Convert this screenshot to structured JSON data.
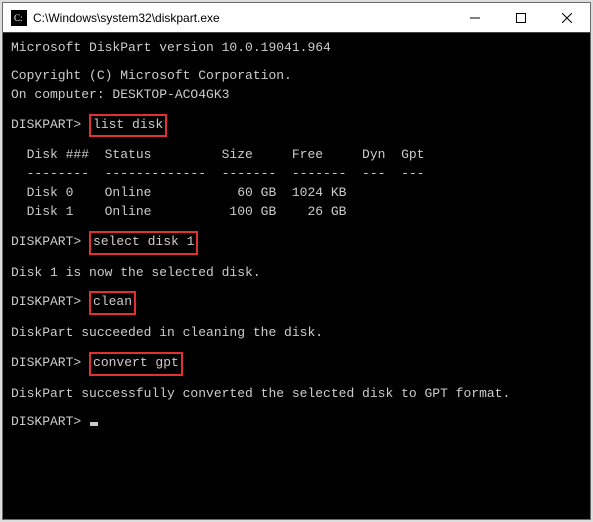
{
  "titlebar": {
    "title": "C:\\Windows\\system32\\diskpart.exe"
  },
  "terminal": {
    "version_line": "Microsoft DiskPart version 10.0.19041.964",
    "copyright": "Copyright (C) Microsoft Corporation.",
    "computer": "On computer: DESKTOP-ACO4GK3",
    "prompt": "DISKPART> ",
    "cmd_list": "list disk",
    "table_header": "  Disk ###  Status         Size     Free     Dyn  Gpt",
    "table_divider": "  --------  -------------  -------  -------  ---  ---",
    "disks": [
      {
        "row": "  Disk 0    Online           60 GB  1024 KB"
      },
      {
        "row": "  Disk 1    Online          100 GB    26 GB"
      }
    ],
    "cmd_select": "select disk 1",
    "select_result": "Disk 1 is now the selected disk.",
    "cmd_clean": "clean",
    "clean_result": "DiskPart succeeded in cleaning the disk.",
    "cmd_convert": "convert gpt",
    "convert_result": "DiskPart successfully converted the selected disk to GPT format."
  }
}
